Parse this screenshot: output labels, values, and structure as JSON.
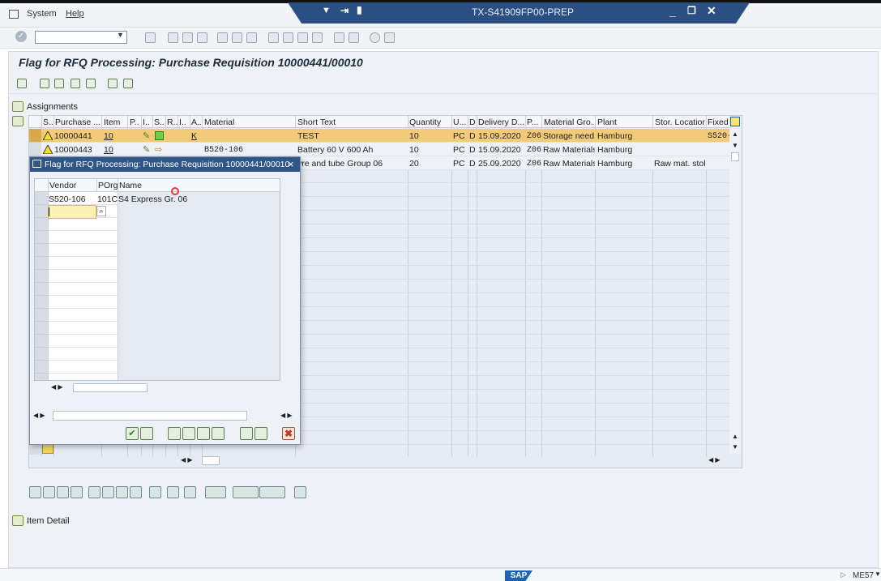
{
  "menu": {
    "system": "System",
    "help": "Help"
  },
  "window": {
    "system_name": "TX-S41909FP00-PREP"
  },
  "page": {
    "title": "Flag for RFQ Processing: Purchase Requisition 10000441/00010"
  },
  "sections": {
    "assignments": "Assignments",
    "item_detail": "Item Detail"
  },
  "grid": {
    "headers": [
      "S..",
      "Purchase ...",
      "Item",
      "P..",
      "I..",
      "S..",
      "R..",
      "I..",
      "A..",
      "Material",
      "Short Text",
      "Quantity",
      "U...",
      "D",
      "Delivery D...",
      "P...",
      "Material Gro...",
      "Plant",
      "Stor. Location",
      "Fixed"
    ],
    "rows": [
      {
        "purchase": "10000441",
        "item": "10",
        "a": "K",
        "material": "",
        "short_text": "TEST",
        "quantity": "10",
        "unit": "PC",
        "d": "D",
        "delivery": "15.09.2020",
        "p": "Z06",
        "mat_group": "Storage need..",
        "plant": "Hamburg",
        "stor_loc": "",
        "fixed": "S520-"
      },
      {
        "purchase": "10000443",
        "item": "10",
        "a": "",
        "material": "B520-106",
        "short_text": "Battery 60 V 600 Ah",
        "quantity": "10",
        "unit": "PC",
        "d": "D",
        "delivery": "15.09.2020",
        "p": "Z06",
        "mat_group": "Raw Materials",
        "plant": "Hamburg",
        "stor_loc": "",
        "fixed": ""
      },
      {
        "purchase": "",
        "item": "",
        "a": "",
        "material": "",
        "short_text": "yre and tube Group 06",
        "quantity": "20",
        "unit": "PC",
        "d": "D",
        "delivery": "25.09.2020",
        "p": "Z06",
        "mat_group": "Raw Materials",
        "plant": "Hamburg",
        "stor_loc": "Raw mat. stol.",
        "fixed": ""
      }
    ]
  },
  "dialog": {
    "title": "Flag for RFQ Processing: Purchase Requisition 10000441/00010",
    "headers": {
      "vendor": "Vendor",
      "porg": "POrg",
      "name": "Name"
    },
    "row": {
      "vendor": "S520-106",
      "porg": "101C",
      "name": "S4 Express Gr. 06"
    }
  },
  "status": {
    "tcode": "ME57"
  },
  "colors": {
    "title_bar": "#2b4f82",
    "selected_row": "#f3c97a",
    "dialog_title": "#2f5687"
  }
}
